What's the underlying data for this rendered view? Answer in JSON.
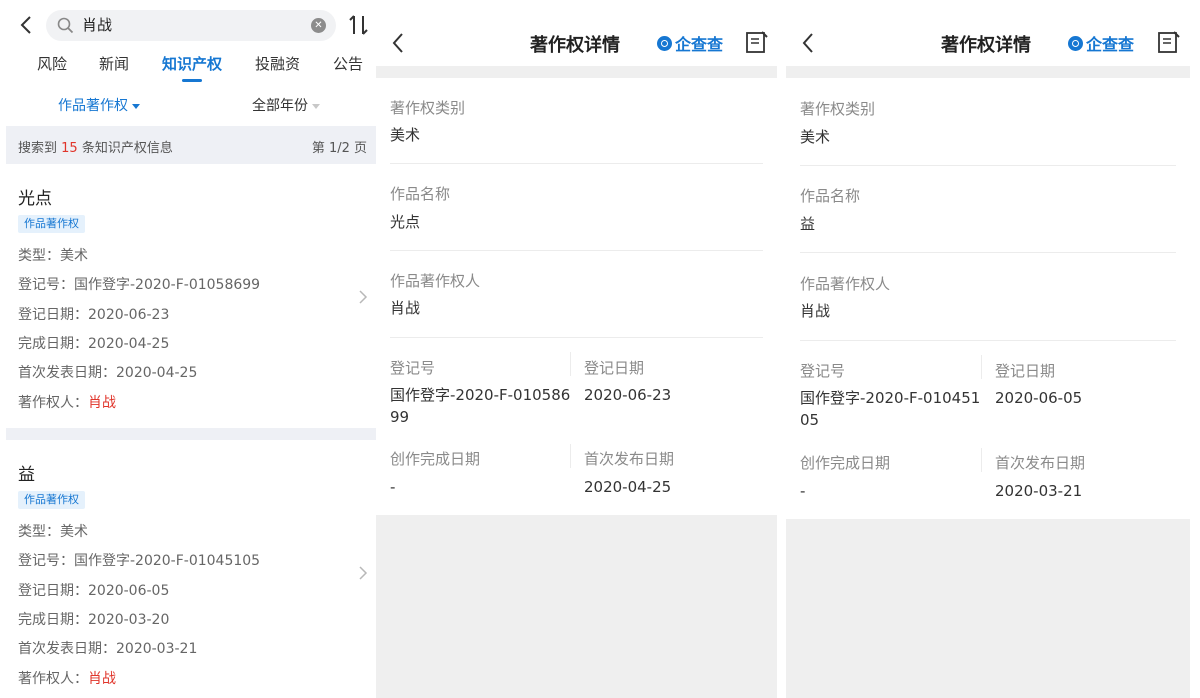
{
  "list": {
    "search_query": "肖战",
    "tabs": [
      "风险",
      "新闻",
      "知识产权",
      "投融资",
      "公告"
    ],
    "active_tab": "知识产权",
    "filter_category": "作品著作权",
    "filter_year": "全部年份",
    "result_prefix": "搜索到",
    "result_count": "15",
    "result_suffix": "条知识产权信息",
    "page_info": "第 1/2 页",
    "items": [
      {
        "title": "光点",
        "tag": "作品著作权",
        "type_label": "类型：",
        "type": "美术",
        "reg_no_label": "登记号：",
        "reg_no": "国作登字-2020-F-01058699",
        "reg_date_label": "登记日期：",
        "reg_date": "2020-06-23",
        "finish_label": "完成日期：",
        "finish_date": "2020-04-25",
        "publish_label": "首次发表日期：",
        "publish_date": "2020-04-25",
        "owner_label": "著作权人：",
        "owner": "肖战"
      },
      {
        "title": "益",
        "tag": "作品著作权",
        "type_label": "类型：",
        "type": "美术",
        "reg_no_label": "登记号：",
        "reg_no": "国作登字-2020-F-01045105",
        "reg_date_label": "登记日期：",
        "reg_date": "2020-06-05",
        "finish_label": "完成日期：",
        "finish_date": "2020-03-20",
        "publish_label": "首次发表日期：",
        "publish_date": "2020-03-21",
        "owner_label": "著作权人：",
        "owner": "肖战"
      }
    ],
    "colors": {
      "accent": "#1677d2",
      "highlight": "#e0352b",
      "band": "#eef0f5"
    }
  },
  "detail_header": {
    "title": "著作权详情",
    "brand": "企查查"
  },
  "detail_labels": {
    "category": "著作权类别",
    "work_name": "作品名称",
    "owner": "作品著作权人",
    "reg_no": "登记号",
    "reg_date": "登记日期",
    "creation_date": "创作完成日期",
    "first_publish": "首次发布日期"
  },
  "details": [
    {
      "category": "美术",
      "work_name": "光点",
      "owner": "肖战",
      "reg_no": "国作登字-2020-F-01058699",
      "reg_date": "2020-06-23",
      "creation_date": "-",
      "first_publish": "2020-04-25"
    },
    {
      "category": "美术",
      "work_name": "益",
      "owner": "肖战",
      "reg_no": "国作登字-2020-F-01045105",
      "reg_date": "2020-06-05",
      "creation_date": "-",
      "first_publish": "2020-03-21"
    }
  ],
  "icons": [
    "back-arrow-icon",
    "search-icon",
    "clear-icon",
    "sort-icon",
    "chevron-right-icon",
    "qcc-logo-icon",
    "document-edit-icon"
  ]
}
